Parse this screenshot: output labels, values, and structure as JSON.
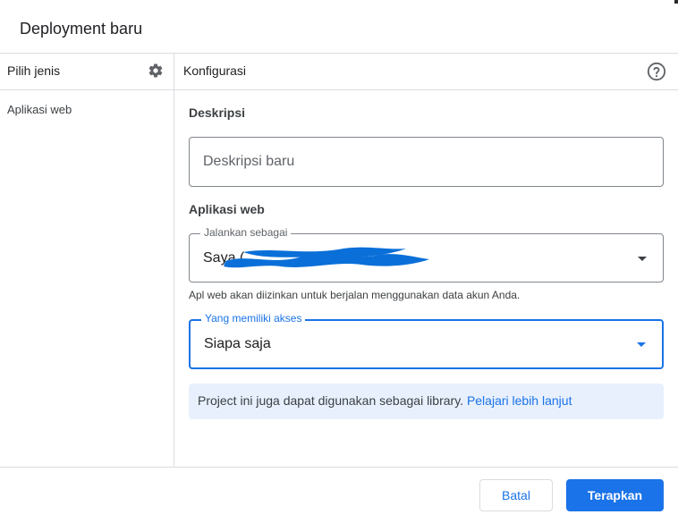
{
  "dialog": {
    "title": "Deployment baru"
  },
  "left_panel": {
    "header": "Pilih jenis",
    "settings_icon": "gear-icon",
    "items": [
      {
        "label": "Aplikasi web"
      }
    ]
  },
  "right_panel": {
    "header": "Konfigurasi",
    "help_icon": "help-circle-icon",
    "description": {
      "section_label": "Deskripsi",
      "placeholder": "Deskripsi baru",
      "value": ""
    },
    "web_app": {
      "section_label": "Aplikasi web",
      "execute_as": {
        "label": "Jalankan sebagai",
        "value": "Saya (",
        "redacted": true
      },
      "hint": "Apl web akan diizinkan untuk berjalan menggunakan data akun Anda.",
      "access": {
        "label": "Yang memiliki akses",
        "value": "Siapa saja"
      }
    },
    "banner": {
      "text": "Project ini juga dapat digunakan sebagai library.",
      "link_text": "Pelajari lebih lanjut"
    }
  },
  "footer": {
    "cancel_label": "Batal",
    "apply_label": "Terapkan"
  },
  "colors": {
    "accent": "#1a73e8",
    "banner_bg": "#e8f0fe",
    "divider": "#dadce0",
    "redaction": "#0a6fd8"
  }
}
